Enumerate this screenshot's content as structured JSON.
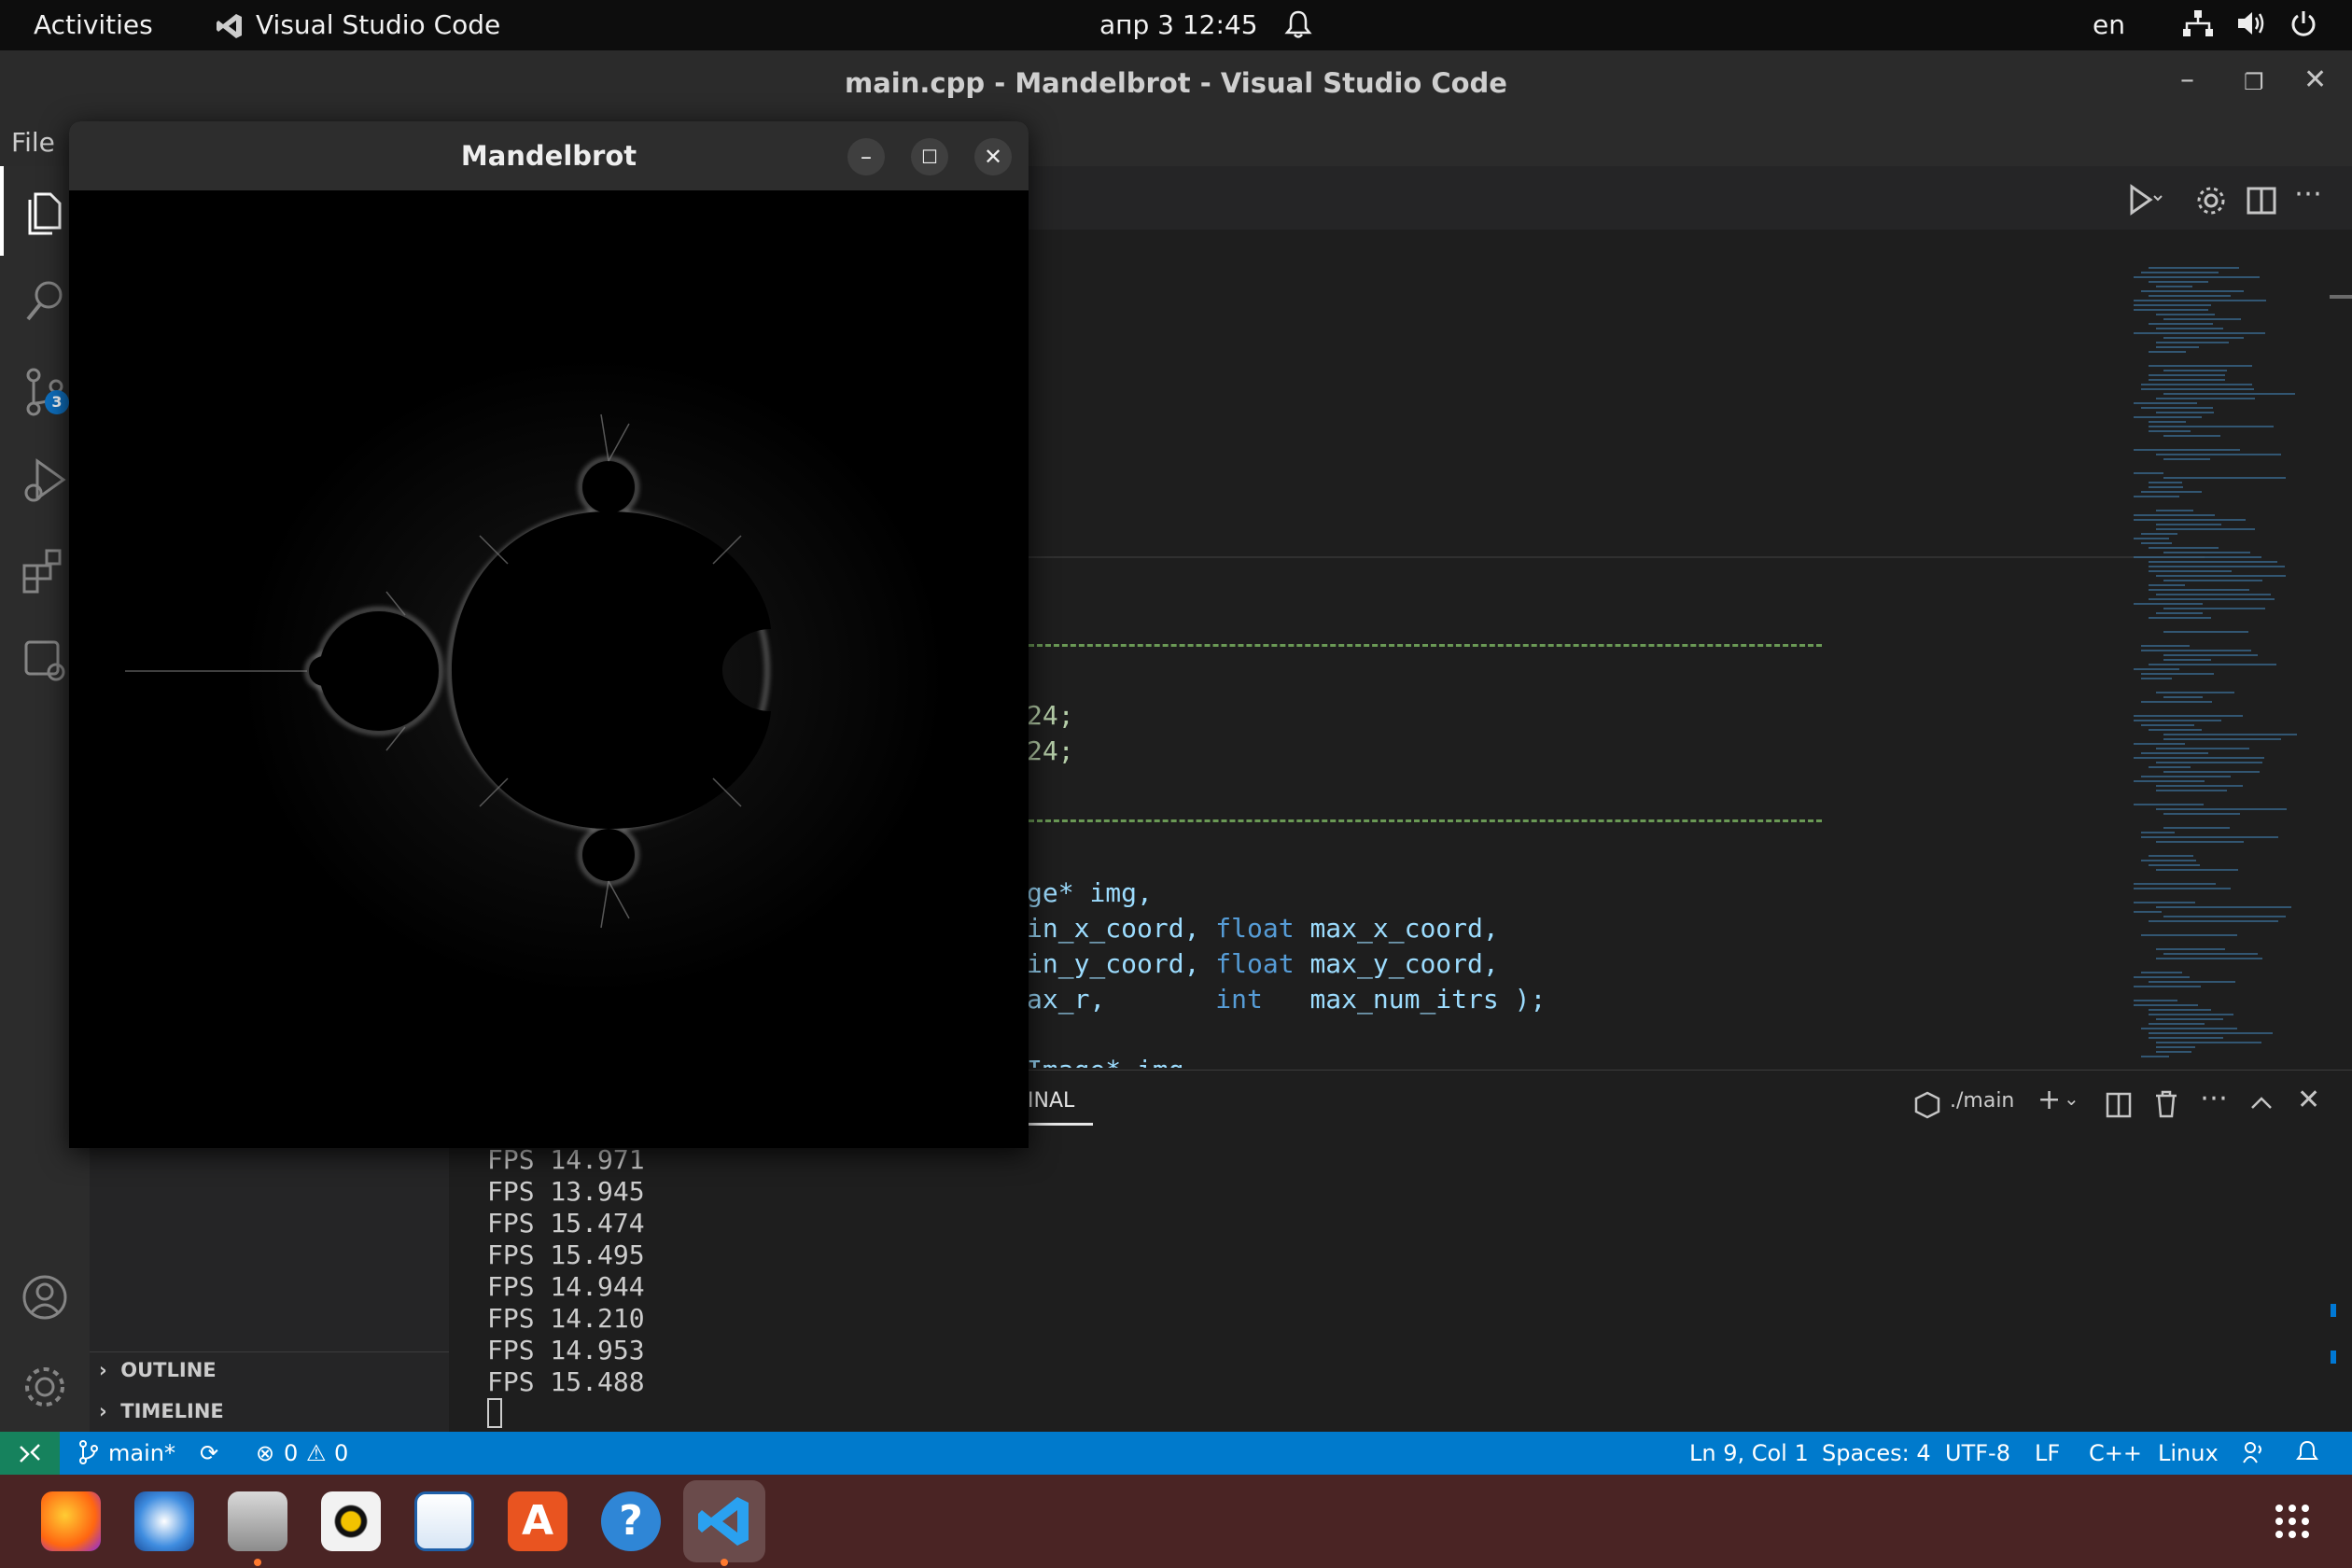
{
  "topbar": {
    "activities": "Activities",
    "app_name": "Visual Studio Code",
    "clock": "апр 3  12:45",
    "lang": "en"
  },
  "titlebar": {
    "title": "main.cpp - Mandelbrot - Visual Studio Code"
  },
  "menu": {
    "file": "File"
  },
  "activity": {
    "scm_badge": "3"
  },
  "editor": {
    "lines": [
      {
        "text": "24;"
      },
      {
        "text": "24;"
      }
    ],
    "decl": {
      "l1_a": "ge* ",
      "l1_b": "img,",
      "l2_a": "in_x_coord, ",
      "l2_kw": "float",
      "l2_b": " max_x_coord,",
      "l3_a": "in_y_coord, ",
      "l3_kw": "float",
      "l3_b": " max_y_coord,",
      "l4_a": "ax_r,       ",
      "l4_kw": "int",
      "l4_b": "   max_num_itrs );",
      "l5_a": "Image* img"
    }
  },
  "panel": {
    "tab_label": "INAL",
    "terminal_name": "./main",
    "fps": [
      "FPS 14.971",
      "FPS 13.945",
      "FPS 15.474",
      "FPS 15.495",
      "FPS 14.944",
      "FPS 14.210",
      "FPS 14.953",
      "FPS 15.488"
    ]
  },
  "sidebar": {
    "outline": "OUTLINE",
    "timeline": "TIMELINE"
  },
  "statusbar": {
    "branch": "main*",
    "errors": "0",
    "warnings": "0",
    "position": "Ln 9, Col 1",
    "spaces": "Spaces: 4",
    "encoding": "UTF-8",
    "eol": "LF",
    "language": "C++",
    "os": "Linux"
  },
  "mandelbrot_window": {
    "title": "Mandelbrot"
  },
  "colors": {
    "status_bg": "#007acc",
    "dock_bg": "#4a2424",
    "editor_bg": "#1e1e1e",
    "accent_green": "#6a9955"
  }
}
